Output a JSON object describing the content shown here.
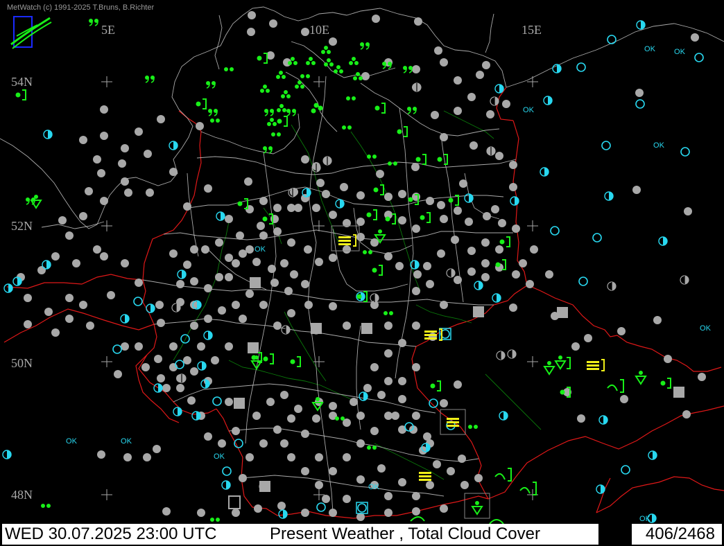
{
  "header": {
    "credit": "MetWatch  (c) 1991-2025 T.Bruns, B.Richter"
  },
  "grid_labels": {
    "lon": [
      "5E",
      "10E",
      "15E"
    ],
    "lat": [
      "54N",
      "52N",
      "50N",
      "48N"
    ]
  },
  "footer": {
    "datetime": "WED 30.07.2025 23:00 UTC",
    "parameter": "Present Weather     , Total Cloud Cover",
    "station_count": "406/2468"
  },
  "ok_label": "OK",
  "colors": {
    "background": "#000000",
    "grey_station": "#a8a8a8",
    "cyan_station": "#28d8f0",
    "green_weather": "#18f018",
    "yellow_weather": "#f0f018",
    "border_red": "#e01818",
    "coast_white": "#c8c8c8",
    "river_green": "#0a7a0a"
  }
}
